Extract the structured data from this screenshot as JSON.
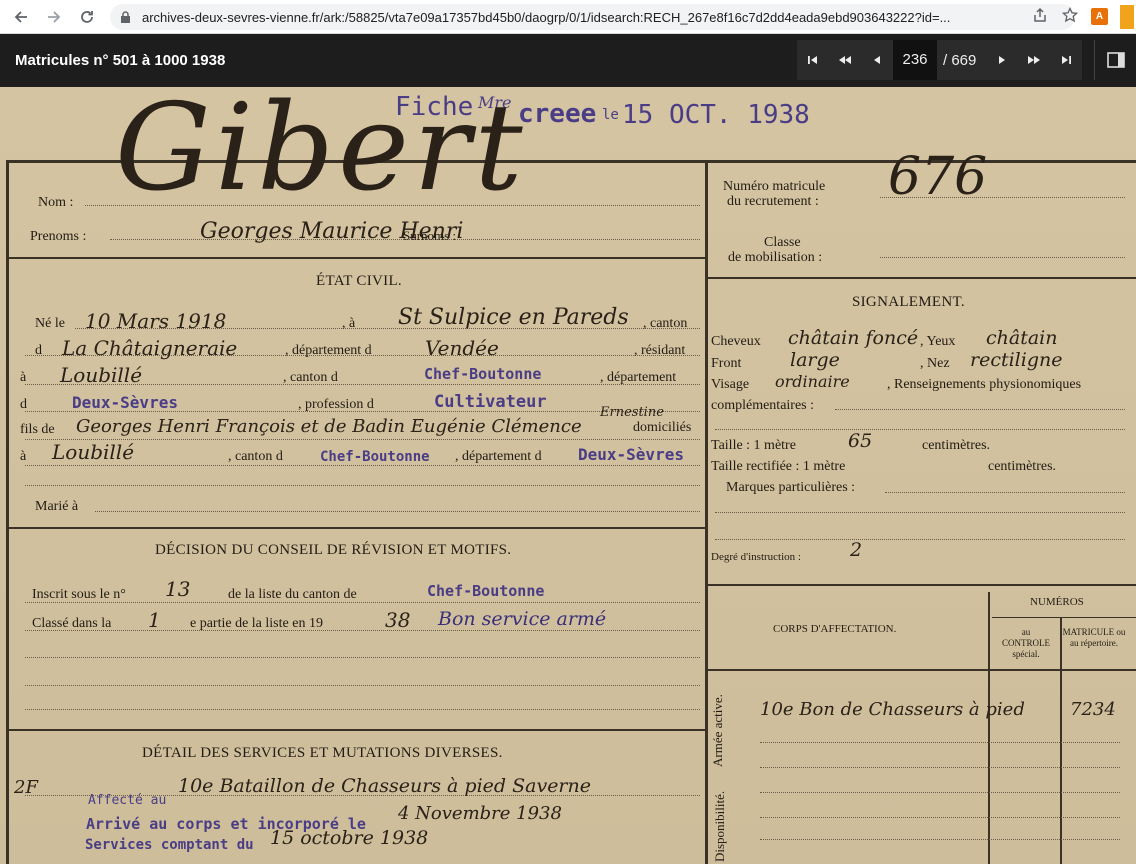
{
  "browser": {
    "url": "archives-deux-sevres-vienne.fr/ark:/58825/vta7e09a17357bd45b0/daogrp/0/1/idsearch:RECH_267e8f16c7d2dd4eada9ebd903643222?id=...",
    "ext_label": "A"
  },
  "viewer": {
    "title": "Matricules n° 501 à 1000 1938",
    "page_current": "236",
    "page_total": "/ 669"
  },
  "document": {
    "stamp_top": "Fiche",
    "stamp_top_hand": "Mre",
    "stamp_top2": "creee",
    "stamp_top3": "le",
    "stamp_date": "15 OCT. 1938",
    "big_name": "Gibert",
    "label_nom": "Nom :",
    "label_prenoms": "Prenoms :",
    "prenoms_value": "Georges Maurice Henri",
    "label_surnoms": "Surnoms :",
    "etat_civil": "ÉTAT CIVIL.",
    "ne_le": "Né le",
    "birth_date": "10 Mars 1918",
    "a": ", à",
    "birth_place": "St Sulpice en Pareds",
    "canton": ", canton",
    "d1": "d",
    "canton_value": "La Châtaigneraie",
    "departement_d": ", département d",
    "dept_value": "Vendée",
    "resident": ", résidant",
    "a2": "à",
    "residence": "Loubillé",
    "canton_d": ", canton d",
    "res_canton": "Chef-Boutonne",
    "departement": ", département",
    "d2": "d",
    "res_dept": "Deux-Sèvres",
    "profession_d": ", profession d",
    "profession_value": "Cultivateur",
    "fils_de": "fils de",
    "parents": "Georges Henri François et de Badin Eugénie Clémence",
    "parents_extra": "Ernestine",
    "domicilies": "domiciliés",
    "a3": "à",
    "parents_place": "Loubillé",
    "canton_d2": ", canton d",
    "parents_canton": "Chef-Boutonne",
    "departement_d2": ", département d",
    "parents_dept": "Deux-Sèvres",
    "marie_a": "Marié à",
    "decision_title": "DÉCISION DU CONSEIL DE RÉVISION ET MOTIFS.",
    "inscrit": "Inscrit sous le n°",
    "inscrit_num": "13",
    "liste_canton": "de la liste du canton de",
    "inscrit_canton": "Chef-Boutonne",
    "classe_dans": "Classé dans la",
    "classe_num": "1",
    "partie": "e partie de la liste en 19",
    "partie_year": "38",
    "bon_service": "Bon service armé",
    "detail_title": "DÉTAIL DES SERVICES ET MUTATIONS DIVERSES.",
    "detail_margin": "2F",
    "detail_line1": "10e Bataillon de Chasseurs à pied  Saverne",
    "affecte": "Affecté au",
    "arrive": "Arrivé au corps et incorporé le",
    "arrive_date": "4 Novembre 1938",
    "services": "Services comptant du",
    "services_date": "15 octobre 1938",
    "numero_matricule_l1": "Numéro matricule",
    "numero_matricule_l2": "du recrutement :",
    "matricule_value": "676",
    "classe_l1": "Classe",
    "classe_l2": "de mobilisation :",
    "signalement": "SIGNALEMENT.",
    "cheveux": "Cheveux",
    "cheveux_value": "châtain foncé",
    "yeux": ", Yeux",
    "yeux_value": "châtain",
    "front": "Front",
    "front_value": "large",
    "nez": ", Nez",
    "nez_value": "rectiligne",
    "visage": "Visage",
    "visage_value": "ordinaire",
    "renseignements": ", Renseignements physionomiques",
    "complementaires": "complémentaires :",
    "taille": "Taille : 1 mètre",
    "taille_value": "65",
    "centimetres": "centimètres.",
    "taille_rect": "Taille rectifiée : 1 mètre",
    "centimetres2": "centimètres.",
    "marques": "Marques particulières :",
    "degre": "Degré d'instruction :",
    "degre_value": "2",
    "numeros": "NUMÉROS",
    "corps_affectation": "CORPS D'AFFECTATION.",
    "au_controle": "au CONTROLE spécial.",
    "matricule_repertoire": "MATRICULE ou au répertoire.",
    "armee_active": "Armée active.",
    "corps_value": "10e Bon de Chasseurs à pied",
    "corps_number": "7234",
    "disponibilite": "Disponibilité."
  }
}
